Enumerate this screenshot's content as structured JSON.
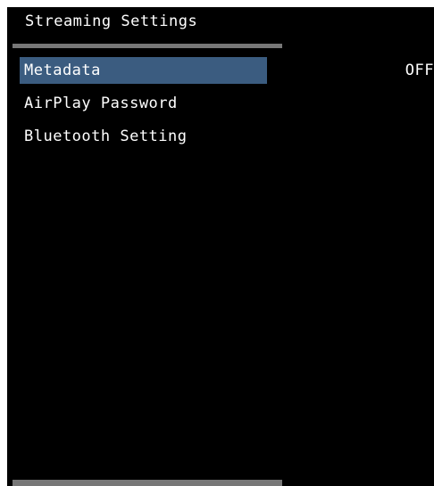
{
  "page": {
    "title": "Streaming Settings"
  },
  "menu": {
    "items": [
      {
        "label": "Metadata",
        "value": "OFF",
        "selected": true
      },
      {
        "label": "AirPlay Password",
        "value": "",
        "selected": false
      },
      {
        "label": "Bluetooth Setting",
        "value": "",
        "selected": false
      }
    ]
  },
  "colors": {
    "background": "#000000",
    "text": "#ffffff",
    "selection": "#3b5c80",
    "divider": "#777777"
  }
}
